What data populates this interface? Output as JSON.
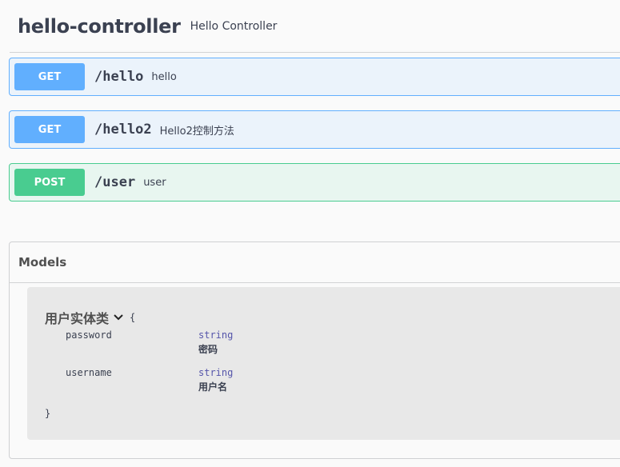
{
  "tag": {
    "name": "hello-controller",
    "description": "Hello Controller"
  },
  "operations": [
    {
      "method": "GET",
      "path": "/hello",
      "summary": "hello"
    },
    {
      "method": "GET",
      "path": "/hello2",
      "summary": "Hello2控制方法"
    },
    {
      "method": "POST",
      "path": "/user",
      "summary": "user"
    }
  ],
  "models": {
    "title": "Models",
    "model": {
      "name": "用户实体类",
      "open_brace": "{",
      "close_brace": "}",
      "properties": [
        {
          "name": "password",
          "type": "string",
          "description": "密码"
        },
        {
          "name": "username",
          "type": "string",
          "description": "用户名"
        }
      ]
    }
  },
  "colors": {
    "get": "#61affe",
    "post": "#49cc90",
    "get_bg": "#ebf3fb",
    "post_bg": "#e8f6f0"
  },
  "icons": {
    "expand": "chevron-down-icon"
  }
}
